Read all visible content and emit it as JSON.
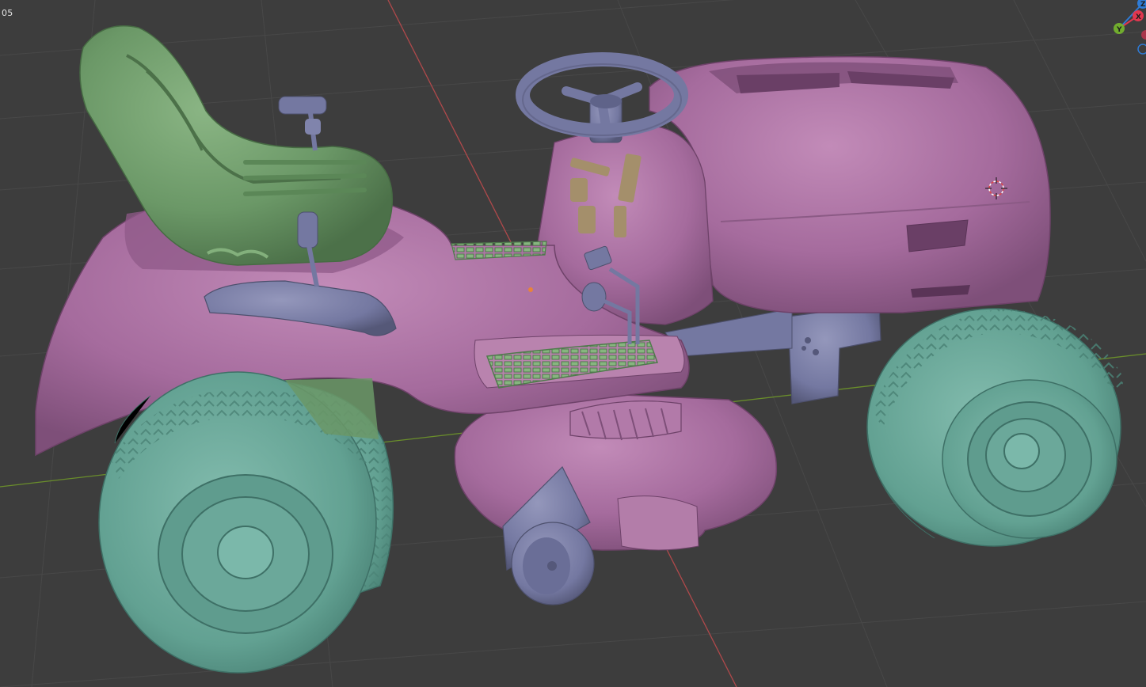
{
  "viewport": {
    "frame_text": "05",
    "background_color": "#3d3d3d",
    "grid_line_color": "#4a4a4a",
    "x_axis_color": "#b0494b",
    "y_axis_color": "#6a8e2b"
  },
  "gizmo": {
    "x_label": "X",
    "y_label": "Y",
    "z_label": "Z",
    "x_color": "#e1374f",
    "y_color": "#71ac2e",
    "z_color": "#2e7bd6"
  },
  "scene": {
    "object": "lawn tractor",
    "part_colors": {
      "body": "#a56b9d",
      "seat": "#6b9867",
      "tires": "#62a192",
      "metal_parts": "#7478a1",
      "controls": "#a48f6b"
    }
  }
}
